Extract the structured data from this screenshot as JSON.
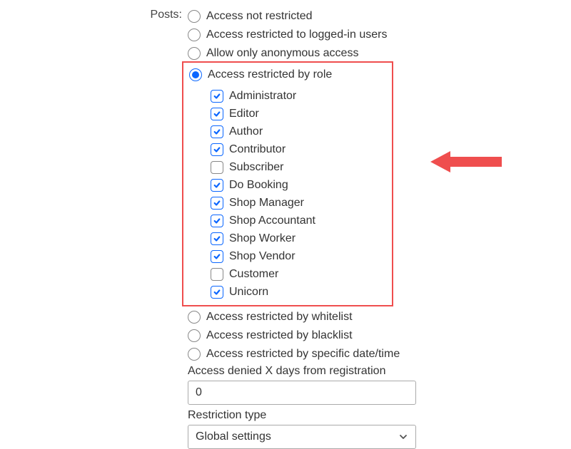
{
  "colors": {
    "accent": "#0a66ff",
    "highlight": "#ef4e4e"
  },
  "row_label": "Posts:",
  "radios_pre": [
    {
      "label": "Access not restricted"
    },
    {
      "label": "Access restricted to logged-in users"
    },
    {
      "label": "Allow only anonymous access"
    }
  ],
  "radio_selected": {
    "label": "Access restricted by role"
  },
  "roles": [
    {
      "label": "Administrator",
      "checked": true
    },
    {
      "label": "Editor",
      "checked": true
    },
    {
      "label": "Author",
      "checked": true
    },
    {
      "label": "Contributor",
      "checked": true
    },
    {
      "label": "Subscriber",
      "checked": false
    },
    {
      "label": "Do Booking",
      "checked": true
    },
    {
      "label": "Shop Manager",
      "checked": true
    },
    {
      "label": "Shop Accountant",
      "checked": true
    },
    {
      "label": "Shop Worker",
      "checked": true
    },
    {
      "label": "Shop Vendor",
      "checked": true
    },
    {
      "label": "Customer",
      "checked": false
    },
    {
      "label": "Unicorn",
      "checked": true
    }
  ],
  "radios_post": [
    {
      "label": "Access restricted by whitelist"
    },
    {
      "label": "Access restricted by blacklist"
    },
    {
      "label": "Access restricted by specific date/time"
    }
  ],
  "denied_days": {
    "label": "Access denied X days from registration",
    "value": "0"
  },
  "restriction_type": {
    "label": "Restriction type",
    "value": "Global settings"
  }
}
